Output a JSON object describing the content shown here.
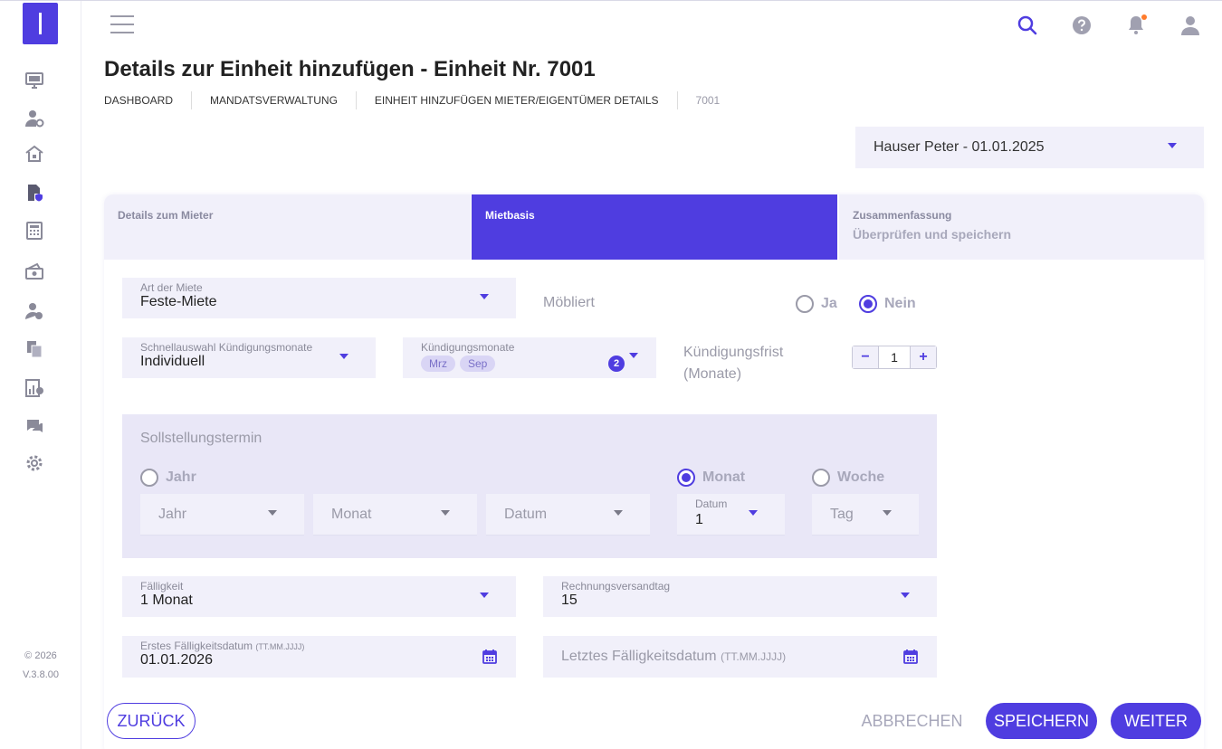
{
  "header": {
    "title": "Details zur Einheit hinzufügen - Einheit Nr. 7001",
    "breadcrumb": [
      "DASHBOARD",
      "MANDATSVERWALTUNG",
      "EINHEIT HINZUFÜGEN MIETER/EIGENTÜMER DETAILS",
      "7001"
    ]
  },
  "sidebar": {
    "icons": [
      "monitor-icon",
      "user-gear-icon",
      "house-icon",
      "document-shield-icon",
      "calculator-icon",
      "money-icon",
      "users-icon",
      "files-icon",
      "chart-icon",
      "chat-icon",
      "gear-icon"
    ],
    "copyright": "© 2026",
    "version": "V.3.8.00"
  },
  "tenant_select": {
    "value": "Hauser Peter - 01.01.2025"
  },
  "tabs": [
    {
      "label": "Details zum Mieter",
      "sub": ""
    },
    {
      "label": "Mietbasis",
      "sub": ""
    },
    {
      "label": "Zusammenfassung",
      "sub": "Überprüfen und speichern"
    }
  ],
  "form": {
    "rent_type": {
      "label": "Art der Miete",
      "value": "Feste-Miete"
    },
    "furnished": {
      "label": "Möbliert",
      "yes": "Ja",
      "no": "Nein",
      "selected": "Nein"
    },
    "quick_select": {
      "label": "Schnellauswahl Kündigungsmonate",
      "value": "Individuell"
    },
    "notice_months": {
      "label": "Kündigungsmonate",
      "chips": [
        "Mrz",
        "Sep"
      ],
      "count": "2"
    },
    "notice_period": {
      "label_line1": "Kündigungsfrist",
      "label_line2": "(Monate)",
      "value": "1",
      "minus": "−",
      "plus": "+"
    },
    "schedule": {
      "title": "Sollstellungstermin",
      "year_option": "Jahr",
      "month_option": "Monat",
      "week_option": "Woche",
      "selected": "Monat",
      "year_select": "Jahr",
      "month_select": "Monat",
      "date_select": "Datum",
      "month_date_label": "Datum",
      "month_date_value": "1",
      "week_day": "Tag"
    },
    "due": {
      "label": "Fälligkeit",
      "value": "1 Monat"
    },
    "invoice_day": {
      "label": "Rechnungsversandtag",
      "value": "15"
    },
    "first_due": {
      "label": "Erstes Fälligkeitsdatum",
      "label_hint": "(TT.MM.JJJJ)",
      "value": "01.01.2026"
    },
    "last_due": {
      "placeholder": "Letztes Fälligkeitsdatum",
      "placeholder_hint": "(TT.MM.JJJJ)"
    }
  },
  "buttons": {
    "back": "ZURÜCK",
    "cancel": "ABBRECHEN",
    "save": "SPEICHERN",
    "next": "WEITER"
  },
  "colors": {
    "accent": "#4f3de0",
    "field_bg": "#f1f0fa",
    "panel_bg": "#e9e7f7",
    "notification": "#ff7b2c"
  }
}
